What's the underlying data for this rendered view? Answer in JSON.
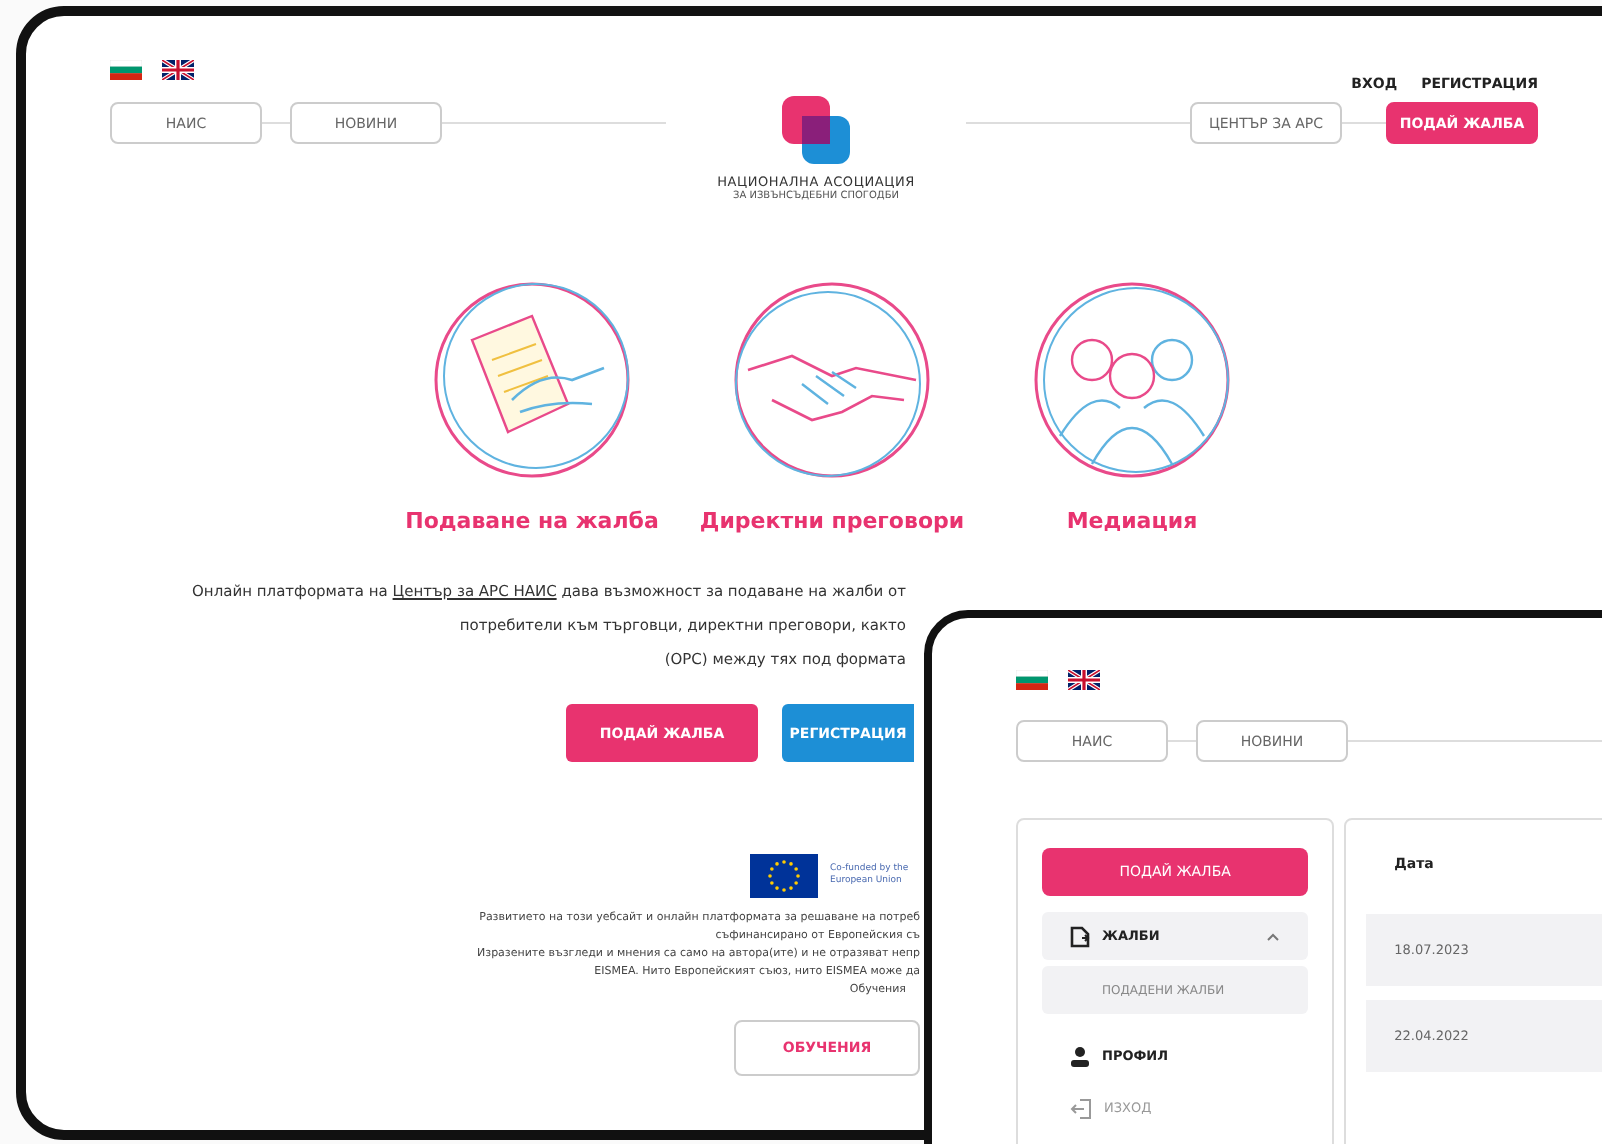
{
  "main_page": {
    "header_links": [
      "ВХОД",
      "РЕГИСТРАЦИЯ"
    ],
    "nav_left": [
      "НАИС",
      "НОВИНИ"
    ],
    "logo": {
      "line1": "НАЦИОНАЛНА АСОЦИАЦИЯ",
      "line2": "ЗА ИЗВЪНСЪДЕБНИ СПОГОДБИ"
    },
    "nav_right": [
      {
        "label": "ЦЕНТЪР ЗА АРС",
        "kind": "outline"
      },
      {
        "label": "ПОДАЙ ЖАЛБА",
        "kind": "primary"
      }
    ],
    "services": [
      {
        "label": "Подаване на жалба",
        "kind": "complaint"
      },
      {
        "label": "Директни преговори",
        "kind": "negotiation"
      },
      {
        "label": "Медиация",
        "kind": "mediation"
      }
    ],
    "intro": {
      "before": "Онлайн платформата на ",
      "link": "Център за АРС НАИС",
      "after": " дава възможност за подаване на жалби от",
      "lines": [
        "потребители към търговци, директни преговори, както",
        "(ОРС) между тях под формата"
      ]
    },
    "actions": [
      {
        "label": "ПОДАЙ ЖАЛБА",
        "kind": "primary"
      },
      {
        "label": "РЕГИСТРАЦИЯ",
        "kind": "secondary"
      }
    ],
    "eu_logo_text": "Co-funded by the European Union",
    "footer_lines": [
      "Развитието на този уебсайт и онлайн платформата за решаване на потреб",
      "съфинансирано от Европейския съ",
      "Изразените възгледи и мнения са само на автора(ите) и не отразяват непр",
      "EISMEA. Нито Европейският съюз, нито EISMEA може да",
      "Обучения"
    ],
    "trainings_button": "ОБУЧЕНИЯ"
  },
  "account_page": {
    "nav": [
      "НАИС",
      "НОВИНИ"
    ],
    "sidebar": {
      "button": "ПОДАЙ ЖАЛБА",
      "items": [
        {
          "label": "ЖАЛБИ",
          "kind": "file",
          "expanded": true,
          "disabled": false,
          "children": [
            {
              "label": "ПОДАДЕНИ ЖАЛБИ"
            }
          ]
        },
        {
          "label": "ПРОФИЛ",
          "kind": "user",
          "disabled": false
        },
        {
          "label": "ИЗХОД",
          "kind": "logout",
          "disabled": true
        }
      ]
    },
    "table": {
      "columns": [
        "Дата"
      ],
      "rows": [
        [
          "18.07.2023"
        ],
        [
          "22.04.2022"
        ]
      ]
    }
  }
}
